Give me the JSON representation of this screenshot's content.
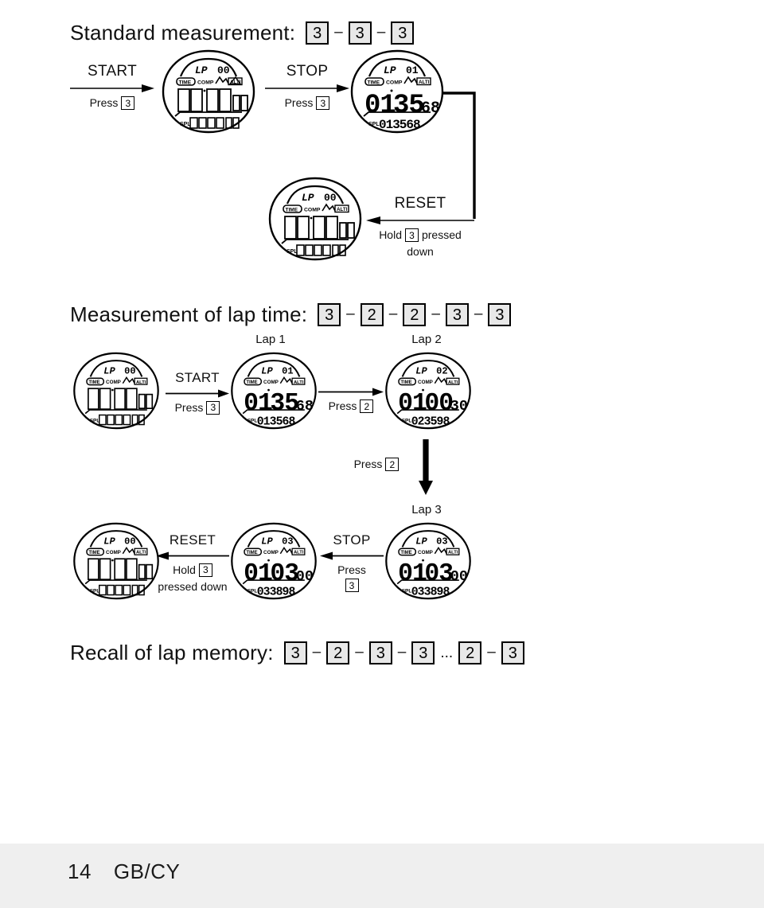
{
  "document": {
    "footer": {
      "page_number": "14",
      "region": "GB/CY"
    }
  },
  "sections": {
    "standard": {
      "title": "Standard measurement:",
      "key_sequence": [
        "3",
        "3",
        "3"
      ],
      "steps": {
        "start": {
          "top_label": "START",
          "bottom_prefix": "Press",
          "key": "3"
        },
        "stop": {
          "top_label": "STOP",
          "bottom_prefix": "Press",
          "key": "3"
        },
        "reset": {
          "top_label": "RESET",
          "bottom_prefix": "Hold",
          "key": "3",
          "bottom_suffix": "pressed",
          "bottom_line2": "down"
        }
      },
      "displays": [
        {
          "lp_label": "LP",
          "lap_number": "00",
          "mode_time": "TIME",
          "mode_comp": "COMP",
          "mode_alti": "ALTI",
          "main_hours": "00",
          "main_minutes": "00",
          "main_small": "00",
          "spl_label": "SPL",
          "spl_value": "000000"
        },
        {
          "lp_label": "LP",
          "lap_number": "01",
          "mode_time": "TIME",
          "mode_comp": "COMP",
          "mode_alti": "ALTI",
          "main_hours": "01",
          "main_minutes": "35",
          "main_small": "68",
          "spl_label": "SPL",
          "spl_value": "013568"
        },
        {
          "lp_label": "LP",
          "lap_number": "00",
          "mode_time": "TIME",
          "mode_comp": "COMP",
          "mode_alti": "ALTI",
          "main_hours": "00",
          "main_minutes": "00",
          "main_small": "00",
          "spl_label": "SPL",
          "spl_value": "000000"
        }
      ]
    },
    "lap_time": {
      "title": "Measurement of lap time:",
      "key_sequence": [
        "3",
        "2",
        "2",
        "3",
        "3"
      ],
      "lap_labels": {
        "lap1": "Lap 1",
        "lap2": "Lap 2",
        "lap3": "Lap 3"
      },
      "steps": {
        "start": {
          "top_label": "START",
          "bottom_prefix": "Press",
          "key": "3"
        },
        "lap": {
          "top_label": "",
          "bottom_prefix": "Press",
          "key": "2"
        },
        "down": {
          "bottom_prefix": "Press",
          "key": "2"
        },
        "stop": {
          "top_label": "STOP",
          "bottom_prefix": "Press",
          "key": "3"
        },
        "reset": {
          "top_label": "RESET",
          "bottom_prefix": "Hold",
          "key": "3",
          "bottom_line2": "pressed down"
        }
      },
      "displays": [
        {
          "lp_label": "LP",
          "lap_number": "00",
          "mode_time": "TIME",
          "mode_comp": "COMP",
          "mode_alti": "ALTI",
          "main_hours": "00",
          "main_minutes": "00",
          "main_small": "00",
          "spl_label": "SPL",
          "spl_value": "000000"
        },
        {
          "lp_label": "LP",
          "lap_number": "01",
          "mode_time": "TIME",
          "mode_comp": "COMP",
          "mode_alti": "ALTI",
          "main_hours": "01",
          "main_minutes": "35",
          "main_small": "68",
          "spl_label": "SPL",
          "spl_value": "013568"
        },
        {
          "lp_label": "LP",
          "lap_number": "02",
          "mode_time": "TIME",
          "mode_comp": "COMP",
          "mode_alti": "ALTI",
          "main_hours": "01",
          "main_minutes": "00",
          "main_small": "30",
          "spl_label": "SPL",
          "spl_value": "023598"
        },
        {
          "lp_label": "LP",
          "lap_number": "03",
          "mode_time": "TIME",
          "mode_comp": "COMP",
          "mode_alti": "ALTI",
          "main_hours": "01",
          "main_minutes": "03",
          "main_small": "00",
          "spl_label": "SPL",
          "spl_value": "033898"
        },
        {
          "lp_label": "LP",
          "lap_number": "03",
          "mode_time": "TIME",
          "mode_comp": "COMP",
          "mode_alti": "ALTI",
          "main_hours": "01",
          "main_minutes": "03",
          "main_small": "00",
          "spl_label": "SPL",
          "spl_value": "033898"
        },
        {
          "lp_label": "LP",
          "lap_number": "00",
          "mode_time": "TIME",
          "mode_comp": "COMP",
          "mode_alti": "ALTI",
          "main_hours": "00",
          "main_minutes": "00",
          "main_small": "00",
          "spl_label": "SPL",
          "spl_value": "000000"
        }
      ]
    },
    "recall": {
      "title": "Recall of lap memory:",
      "key_sequence": [
        "3",
        "2",
        "3",
        "3",
        "...",
        "2",
        "3"
      ]
    }
  },
  "colors": {
    "ink": "#111111",
    "key_fill": "#e8e8e8",
    "page_bg": "#ffffff",
    "margin_bg": "#efefef"
  }
}
